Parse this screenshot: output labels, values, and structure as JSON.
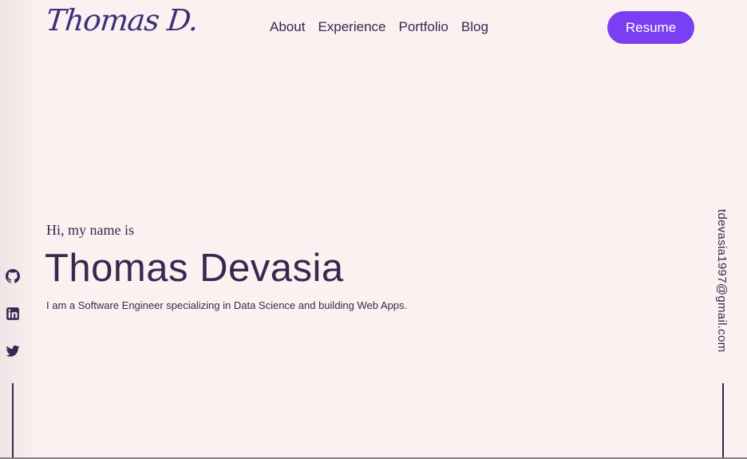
{
  "header": {
    "logo_text": "Thomas D.",
    "nav": [
      {
        "label": "About"
      },
      {
        "label": "Experience"
      },
      {
        "label": "Portfolio"
      },
      {
        "label": "Blog"
      }
    ],
    "resume_label": "Resume"
  },
  "hero": {
    "greeting": "Hi, my name is",
    "name": "Thomas Devasia",
    "tagline": "I am a Software Engineer specializing in Data Science and building Web Apps."
  },
  "social": {
    "icons": [
      "github-icon",
      "linkedin-icon",
      "twitter-icon"
    ]
  },
  "email": "tdevasia1997@gmail.com",
  "colors": {
    "background": "#faf1f0",
    "text": "#3a2750",
    "accent": "#7b3ff3",
    "logo": "#3d2f7a"
  }
}
